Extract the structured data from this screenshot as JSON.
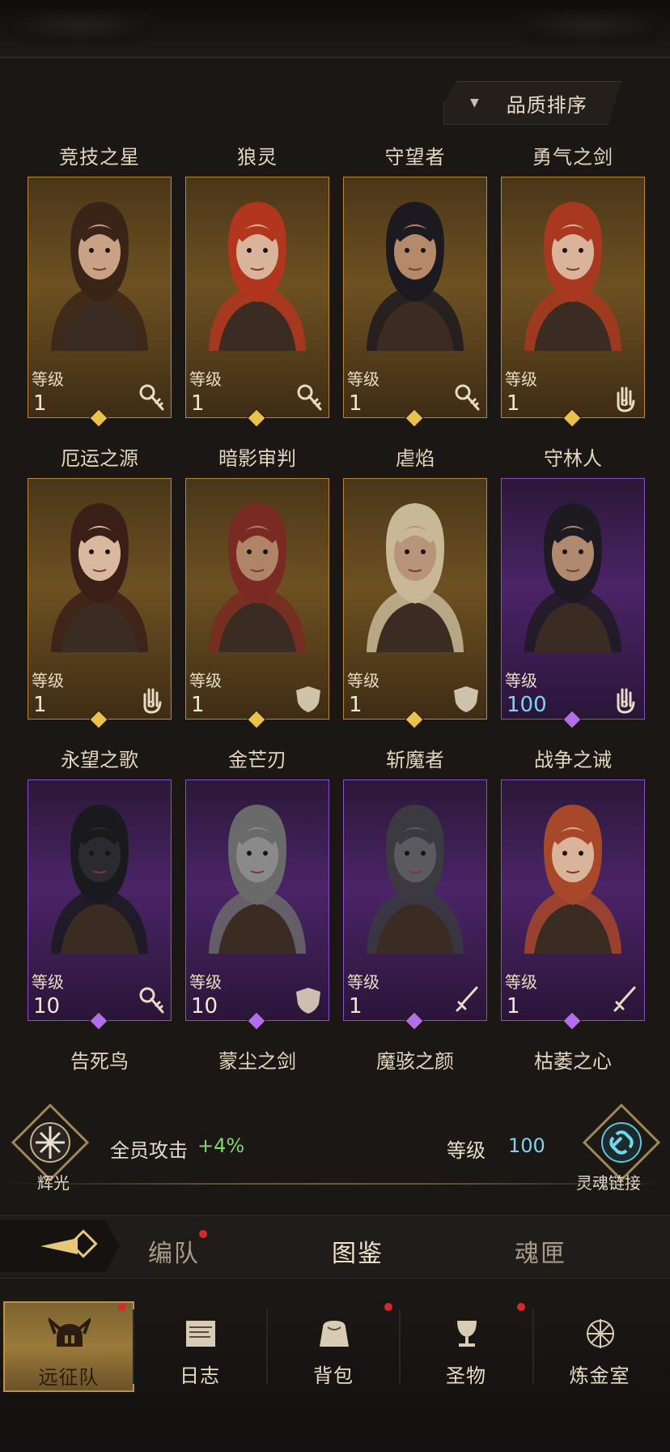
{
  "sort_button": {
    "label": "品质排序"
  },
  "level_label": "等级",
  "heroes": [
    {
      "name": "竞技之星",
      "level": "1",
      "rarity": "gold",
      "class_icon": "key-staff-icon",
      "skin": "#c9a184",
      "hair": "#3a2418"
    },
    {
      "name": "狼灵",
      "level": "1",
      "rarity": "gold",
      "class_icon": "key-staff-icon",
      "skin": "#d9b49a",
      "hair": "#b2361e"
    },
    {
      "name": "守望者",
      "level": "1",
      "rarity": "gold",
      "class_icon": "key-staff-icon",
      "skin": "#b48a6a",
      "hair": "#1c1a20"
    },
    {
      "name": "勇气之剑",
      "level": "1",
      "rarity": "gold",
      "class_icon": "hand-icon",
      "skin": "#d9b49a",
      "hair": "#a83820"
    },
    {
      "name": "厄运之源",
      "level": "1",
      "rarity": "gold",
      "class_icon": "hand-icon",
      "skin": "#d9b8a0",
      "hair": "#3a1e18"
    },
    {
      "name": "暗影审判",
      "level": "1",
      "rarity": "gold",
      "class_icon": "shield-icon",
      "skin": "#b08466",
      "hair": "#7a2a22"
    },
    {
      "name": "虐焰",
      "level": "1",
      "rarity": "gold",
      "class_icon": "shield-icon",
      "skin": "#b89478",
      "hair": "#c8b898"
    },
    {
      "name": "守林人",
      "level": "100",
      "rarity": "purple",
      "class_icon": "hand-icon",
      "skin": "#b08a70",
      "hair": "#1e1a22"
    },
    {
      "name": "永望之歌",
      "level": "10",
      "rarity": "purple",
      "class_icon": "key-staff-icon",
      "skin": "#2a2a30",
      "hair": "#1a1a1e"
    },
    {
      "name": "金芒刃",
      "level": "10",
      "rarity": "purple",
      "class_icon": "shield-icon",
      "skin": "#8a8a8a",
      "hair": "#6a6a6a"
    },
    {
      "name": "斩魔者",
      "level": "1",
      "rarity": "purple",
      "class_icon": "sword-icon",
      "skin": "#5a5a60",
      "hair": "#3a3a40"
    },
    {
      "name": "战争之诫",
      "level": "1",
      "rarity": "purple",
      "class_icon": "sword-icon",
      "skin": "#d9b49a",
      "hair": "#a8482a"
    }
  ],
  "row_names_below": [
    "永望之歌",
    "金芒刃",
    "斩魔者",
    "战争之诫"
  ],
  "extra_names": [
    "告死鸟",
    "蒙尘之剑",
    "魔骇之颜",
    "枯萎之心"
  ],
  "stats": {
    "left_badge": "辉光",
    "left_text": "全员攻击",
    "left_value": "+4%",
    "right_label": "等级",
    "right_value": "100",
    "right_badge": "灵魂链接"
  },
  "subtabs": [
    {
      "label": "编队",
      "active": false,
      "dot": true
    },
    {
      "label": "图鉴",
      "active": true,
      "dot": false
    },
    {
      "label": "魂匣",
      "active": false,
      "dot": false
    }
  ],
  "nav": [
    {
      "label": "远征队",
      "icon": "helmet-icon",
      "active": true,
      "dot": true
    },
    {
      "label": "日志",
      "icon": "scroll-icon",
      "active": false,
      "dot": false
    },
    {
      "label": "背包",
      "icon": "bag-icon",
      "active": false,
      "dot": true
    },
    {
      "label": "圣物",
      "icon": "chalice-icon",
      "active": false,
      "dot": true
    },
    {
      "label": "炼金室",
      "icon": "alchemy-icon",
      "active": false,
      "dot": false
    }
  ]
}
